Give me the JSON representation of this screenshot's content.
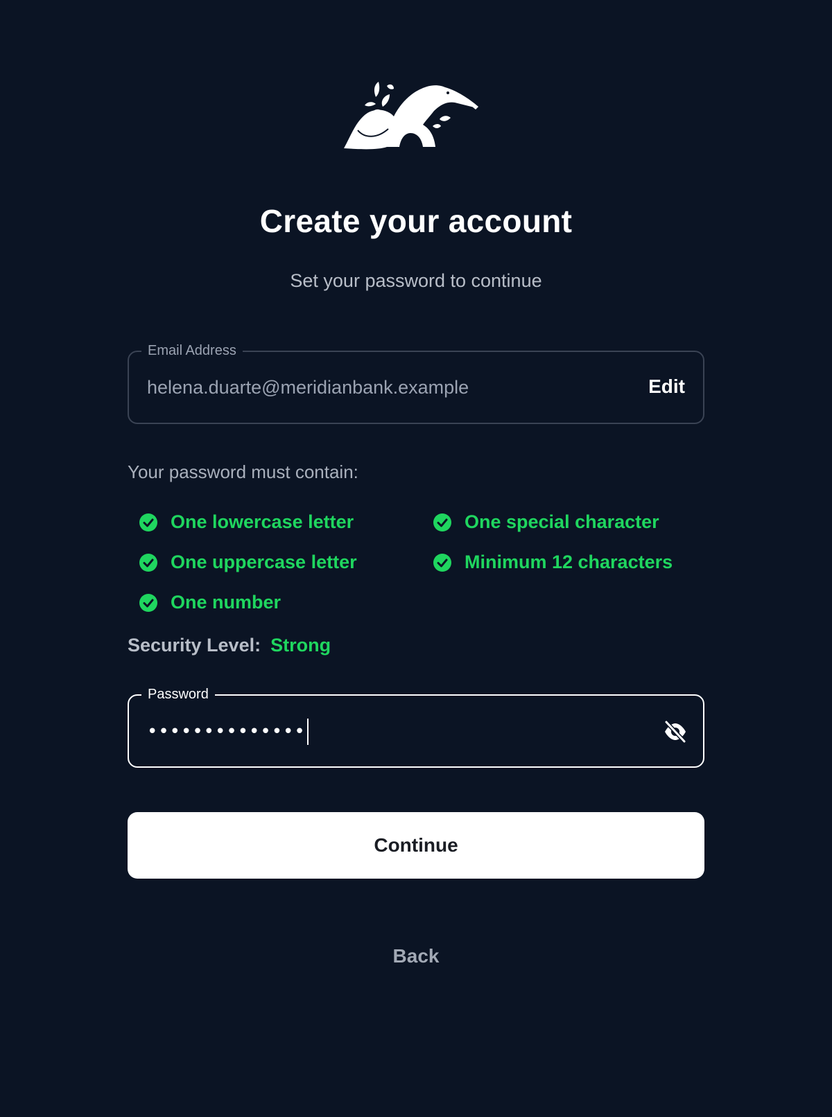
{
  "header": {
    "logo_icon": "anteater-leaf-logo-icon",
    "title": "Create your account",
    "subtitle": "Set your password to continue"
  },
  "email_field": {
    "label": "Email Address",
    "value": "helena.duarte@meridianbank.example",
    "edit_label": "Edit"
  },
  "requirements": {
    "title": "Your password must contain:",
    "items": [
      {
        "label": "One lowercase letter",
        "met": true
      },
      {
        "label": "One special character",
        "met": true
      },
      {
        "label": "One uppercase letter",
        "met": true
      },
      {
        "label": "Minimum 12 characters",
        "met": true
      },
      {
        "label": "One number",
        "met": true
      }
    ],
    "check_icon": "check-circle-icon",
    "met_color": "#1fd65f"
  },
  "security": {
    "label": "Security Level:",
    "value": "Strong"
  },
  "password_field": {
    "label": "Password",
    "masked_value": "••••••••••••••",
    "toggle_icon": "eye-off-icon"
  },
  "actions": {
    "continue_label": "Continue",
    "back_label": "Back"
  },
  "colors": {
    "background": "#0b1424",
    "accent_green": "#1fd65f",
    "button_bg": "#ffffff"
  }
}
